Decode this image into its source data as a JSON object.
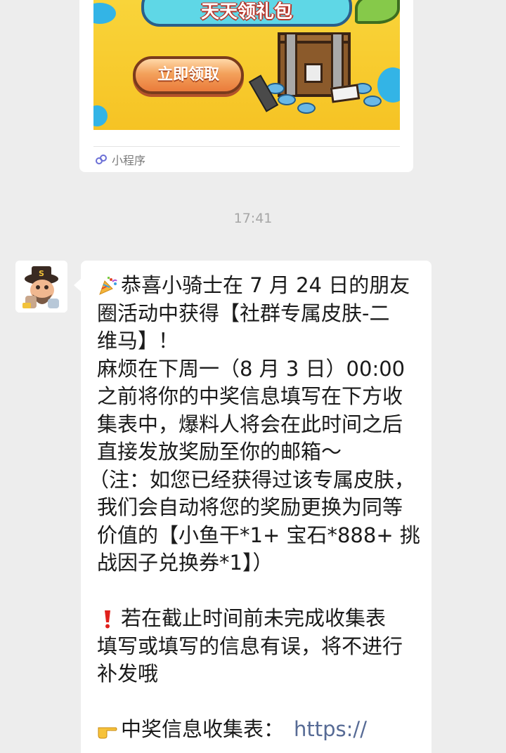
{
  "mini_program": {
    "banner_title": "天天领礼包",
    "banner_button": "立即领取",
    "label": "小程序"
  },
  "timestamp": "17:41",
  "message": {
    "sender": "avatar",
    "lines": [
      "恭喜小骑士在 7 月 24 日的朋友",
      "圈活动中获得【社群专属皮肤-二",
      "维马】！",
      "麻烦在下周一（8 月 3 日）00:00",
      "之前将你的中奖信息填写在下方收",
      "集表中，爆料人将会在此时间之后",
      "直接发放奖励至你的邮箱～",
      "（注：如您已经获得过该专属皮肤，",
      "我们会自动将您的奖励更换为同等",
      "价值的【小鱼干*1+ 宝石*888+ 挑",
      "战因子兑换券*1】）",
      "",
      "若在截止时间前未完成收集表",
      "填写或填写的信息有误，将不进行",
      "补发哦",
      "",
      "中奖信息收集表：",
      "https://"
    ],
    "icons": [
      "party-popper-icon",
      "exclamation-icon",
      "pointing-hand-icon"
    ]
  },
  "colors": {
    "background": "#ededed",
    "bubble": "#ffffff",
    "link": "#576b95",
    "timestamp": "#a6a6a6",
    "alert_red": "#e0201c"
  }
}
